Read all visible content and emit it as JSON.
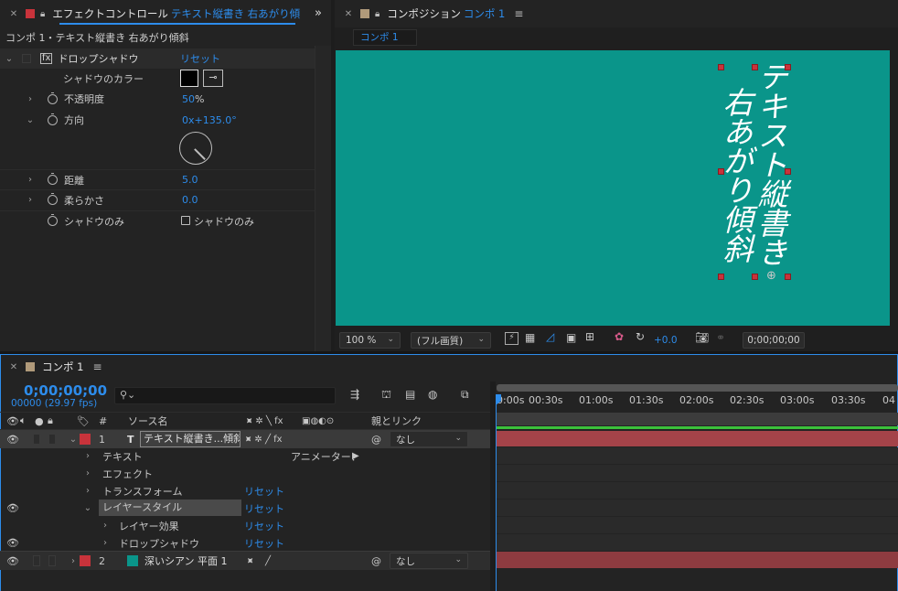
{
  "effect_panel": {
    "tab_title": "エフェクトコントロール",
    "tab_layer": "テキスト縦書き 右あがり傾",
    "breadcrumb": "コンポ 1・テキスト縦書き 右あがり傾斜",
    "effect_name": "ドロップシャドウ",
    "effect_reset": "リセット",
    "props": {
      "color_label": "シャドウのカラー",
      "opacity_label": "不透明度",
      "opacity_value": "50",
      "opacity_unit": "%",
      "direction_label": "方向",
      "direction_value": "0x+135.0°",
      "distance_label": "距離",
      "distance_value": "5.0",
      "softness_label": "柔らかさ",
      "softness_value": "0.0",
      "shadow_only_label": "シャドウのみ",
      "shadow_only_checkbox": "シャドウのみ"
    }
  },
  "comp_panel": {
    "tab_title": "コンポジション",
    "tab_comp": "コンポ 1",
    "chip": "コンポ 1",
    "canvas_text_col1": "テキスト縦書き",
    "canvas_text_col2": "右あがり傾斜",
    "zoom": "100 %",
    "quality": "(フル画質)",
    "exposure": "+0.0",
    "timecode": "0;00;00;00",
    "bg_color": "#0a958a"
  },
  "timeline": {
    "tab_title": "コンポ 1",
    "timecode": "0;00;00;00",
    "frames": "00000 (29.97 fps)",
    "search_placeholder": "",
    "col_num": "#",
    "col_source": "ソース名",
    "col_switches": "⯍ ✲ ╲ fx",
    "col_parent": "親とリンク",
    "ruler": [
      "0:00s",
      "00:30s",
      "01:00s",
      "01:30s",
      "02:00s",
      "02:30s",
      "03:00s",
      "03:30s",
      "04"
    ],
    "layer1_num": "1",
    "layer1_type": "T",
    "layer1_name": "テキスト縦書き...傾斜",
    "layer1_parent": "なし",
    "text_group": "テキスト",
    "animator_label": "アニメーター：",
    "effects_group": "エフェクト",
    "transform_group": "トランスフォーム",
    "transform_reset": "リセット",
    "layer_style_group": "レイヤースタイル",
    "layer_style_reset": "リセット",
    "layer_effect_group": "レイヤー効果",
    "layer_effect_reset": "リセット",
    "drop_shadow_group": "ドロップシャドウ",
    "drop_shadow_reset": "リセット",
    "layer2_num": "2",
    "layer2_name": "深いシアン 平面 1",
    "layer2_parent": "なし",
    "label_red": "#c8333b",
    "label_teal": "#0a958a"
  }
}
